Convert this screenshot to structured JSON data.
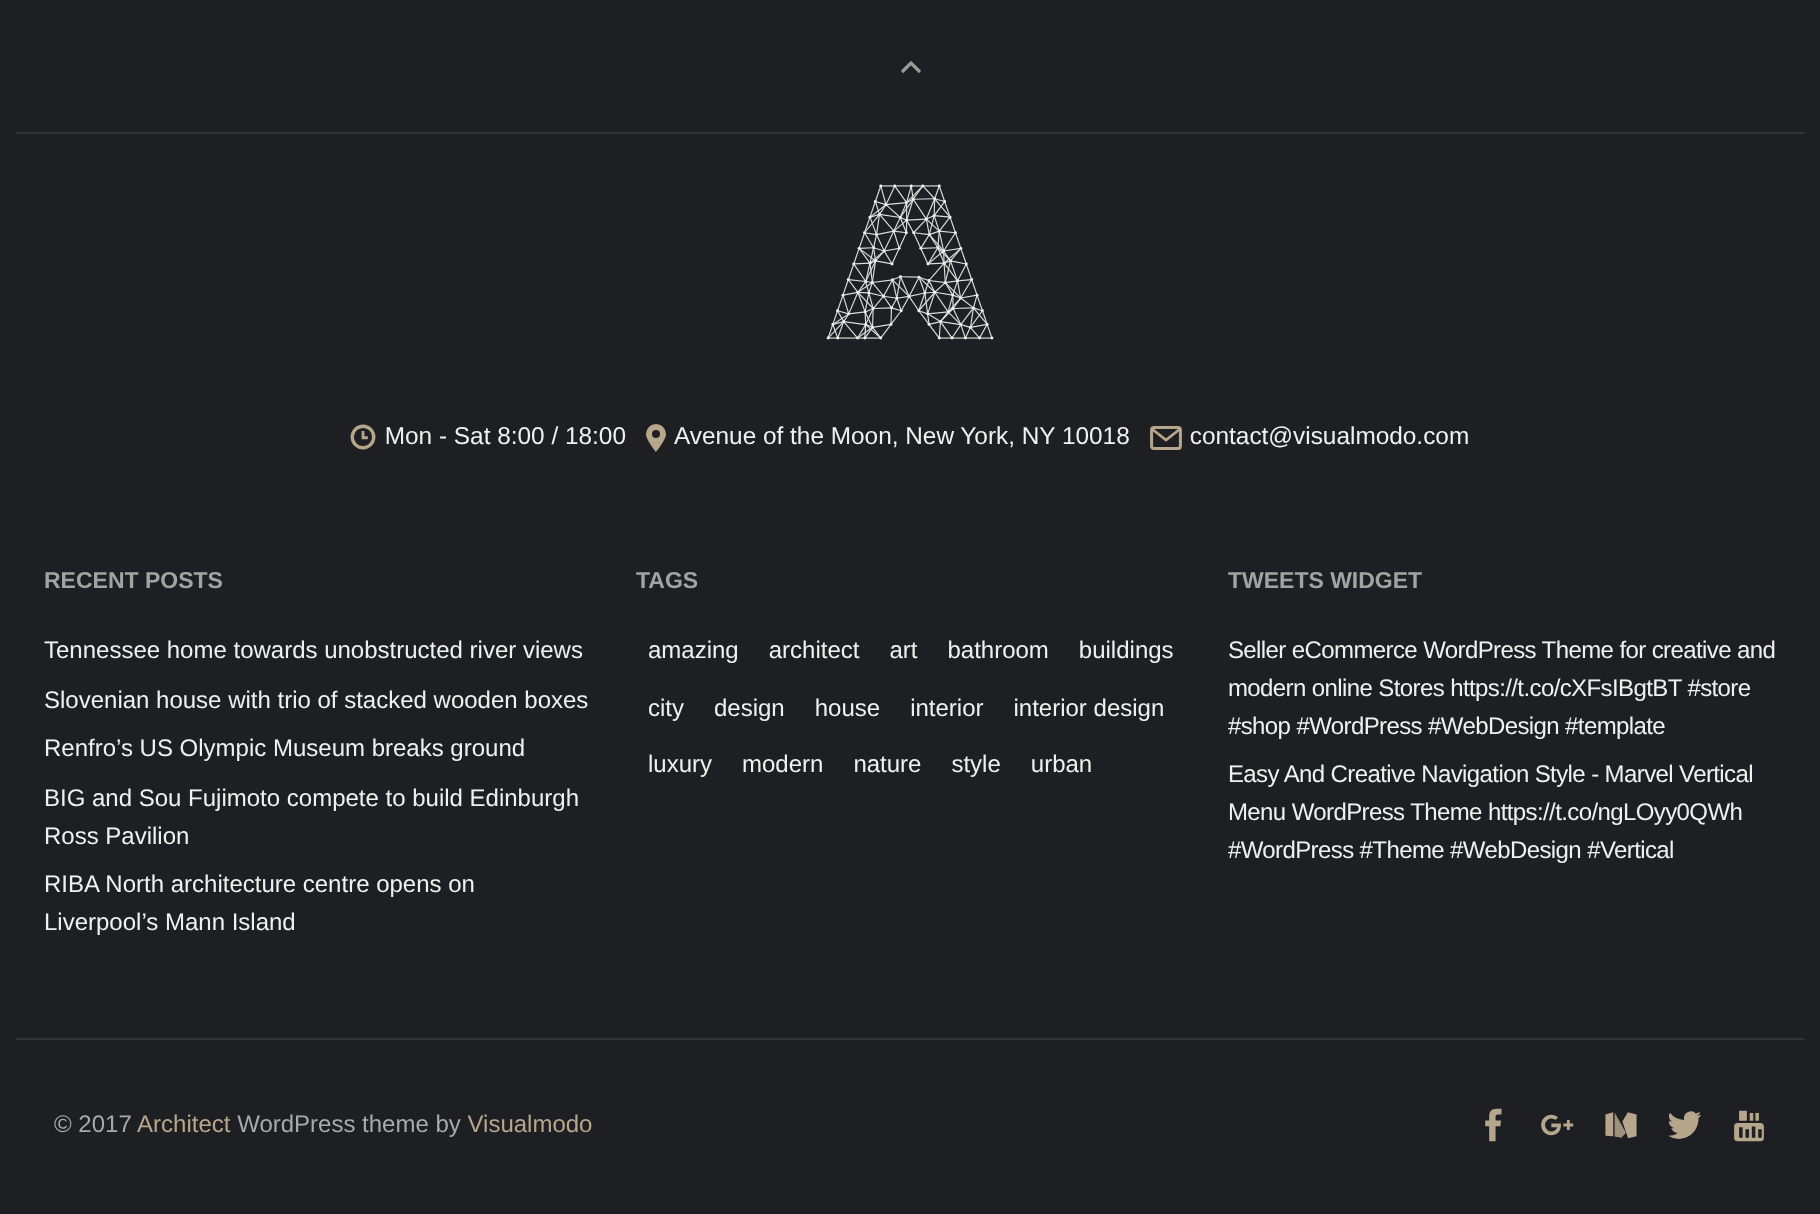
{
  "contact": [
    {
      "kind": "hours",
      "text": "Mon - Sat 8:00 / 18:00"
    },
    {
      "kind": "address",
      "text": "Avenue of the Moon, New York, NY 10018"
    },
    {
      "kind": "email",
      "text": "contact@visualmodo.com"
    }
  ],
  "recent_posts": {
    "title": "RECENT POSTS",
    "posts": [
      "Tennessee home towards unobstructed river views",
      "Slovenian house with trio of stacked wooden boxes",
      "Renfro’s US Olympic Museum breaks ground",
      "BIG and Sou Fujimoto compete to build Edinburgh Ross Pavilion",
      "RIBA North architecture centre opens on Liverpool’s Mann Island"
    ]
  },
  "tags": {
    "title": "TAGS",
    "tags": [
      "amazing",
      "architect",
      "art",
      "bathroom",
      "buildings",
      "city",
      "design",
      "house",
      "interior",
      "interior design",
      "luxury",
      "modern",
      "nature",
      "style",
      "urban"
    ]
  },
  "tweets": {
    "title": "TWEETS WIDGET",
    "tweets": [
      "Seller eCommerce WordPress Theme for creative and modern online Stores https://t.co/cXFsIBgtBT #store #shop #WordPress #WebDesign #template",
      "Easy And Creative Navigation Style - Marvel Vertical Menu WordPress Theme https://t.co/ngLOyy0QWh #WordPress #Theme #WebDesign #Vertical"
    ]
  },
  "footer": {
    "copyright": [
      {
        "kind": "text",
        "text": "© 2017"
      },
      {
        "kind": "link",
        "text": "Architect"
      },
      {
        "kind": "text",
        "text": "WordPress theme by"
      },
      {
        "kind": "link",
        "text": "Visualmodo"
      }
    ],
    "social": [
      {
        "kind": "facebook"
      },
      {
        "kind": "google_plus"
      },
      {
        "kind": "medium"
      },
      {
        "kind": "twitter"
      },
      {
        "kind": "youtube"
      }
    ]
  }
}
